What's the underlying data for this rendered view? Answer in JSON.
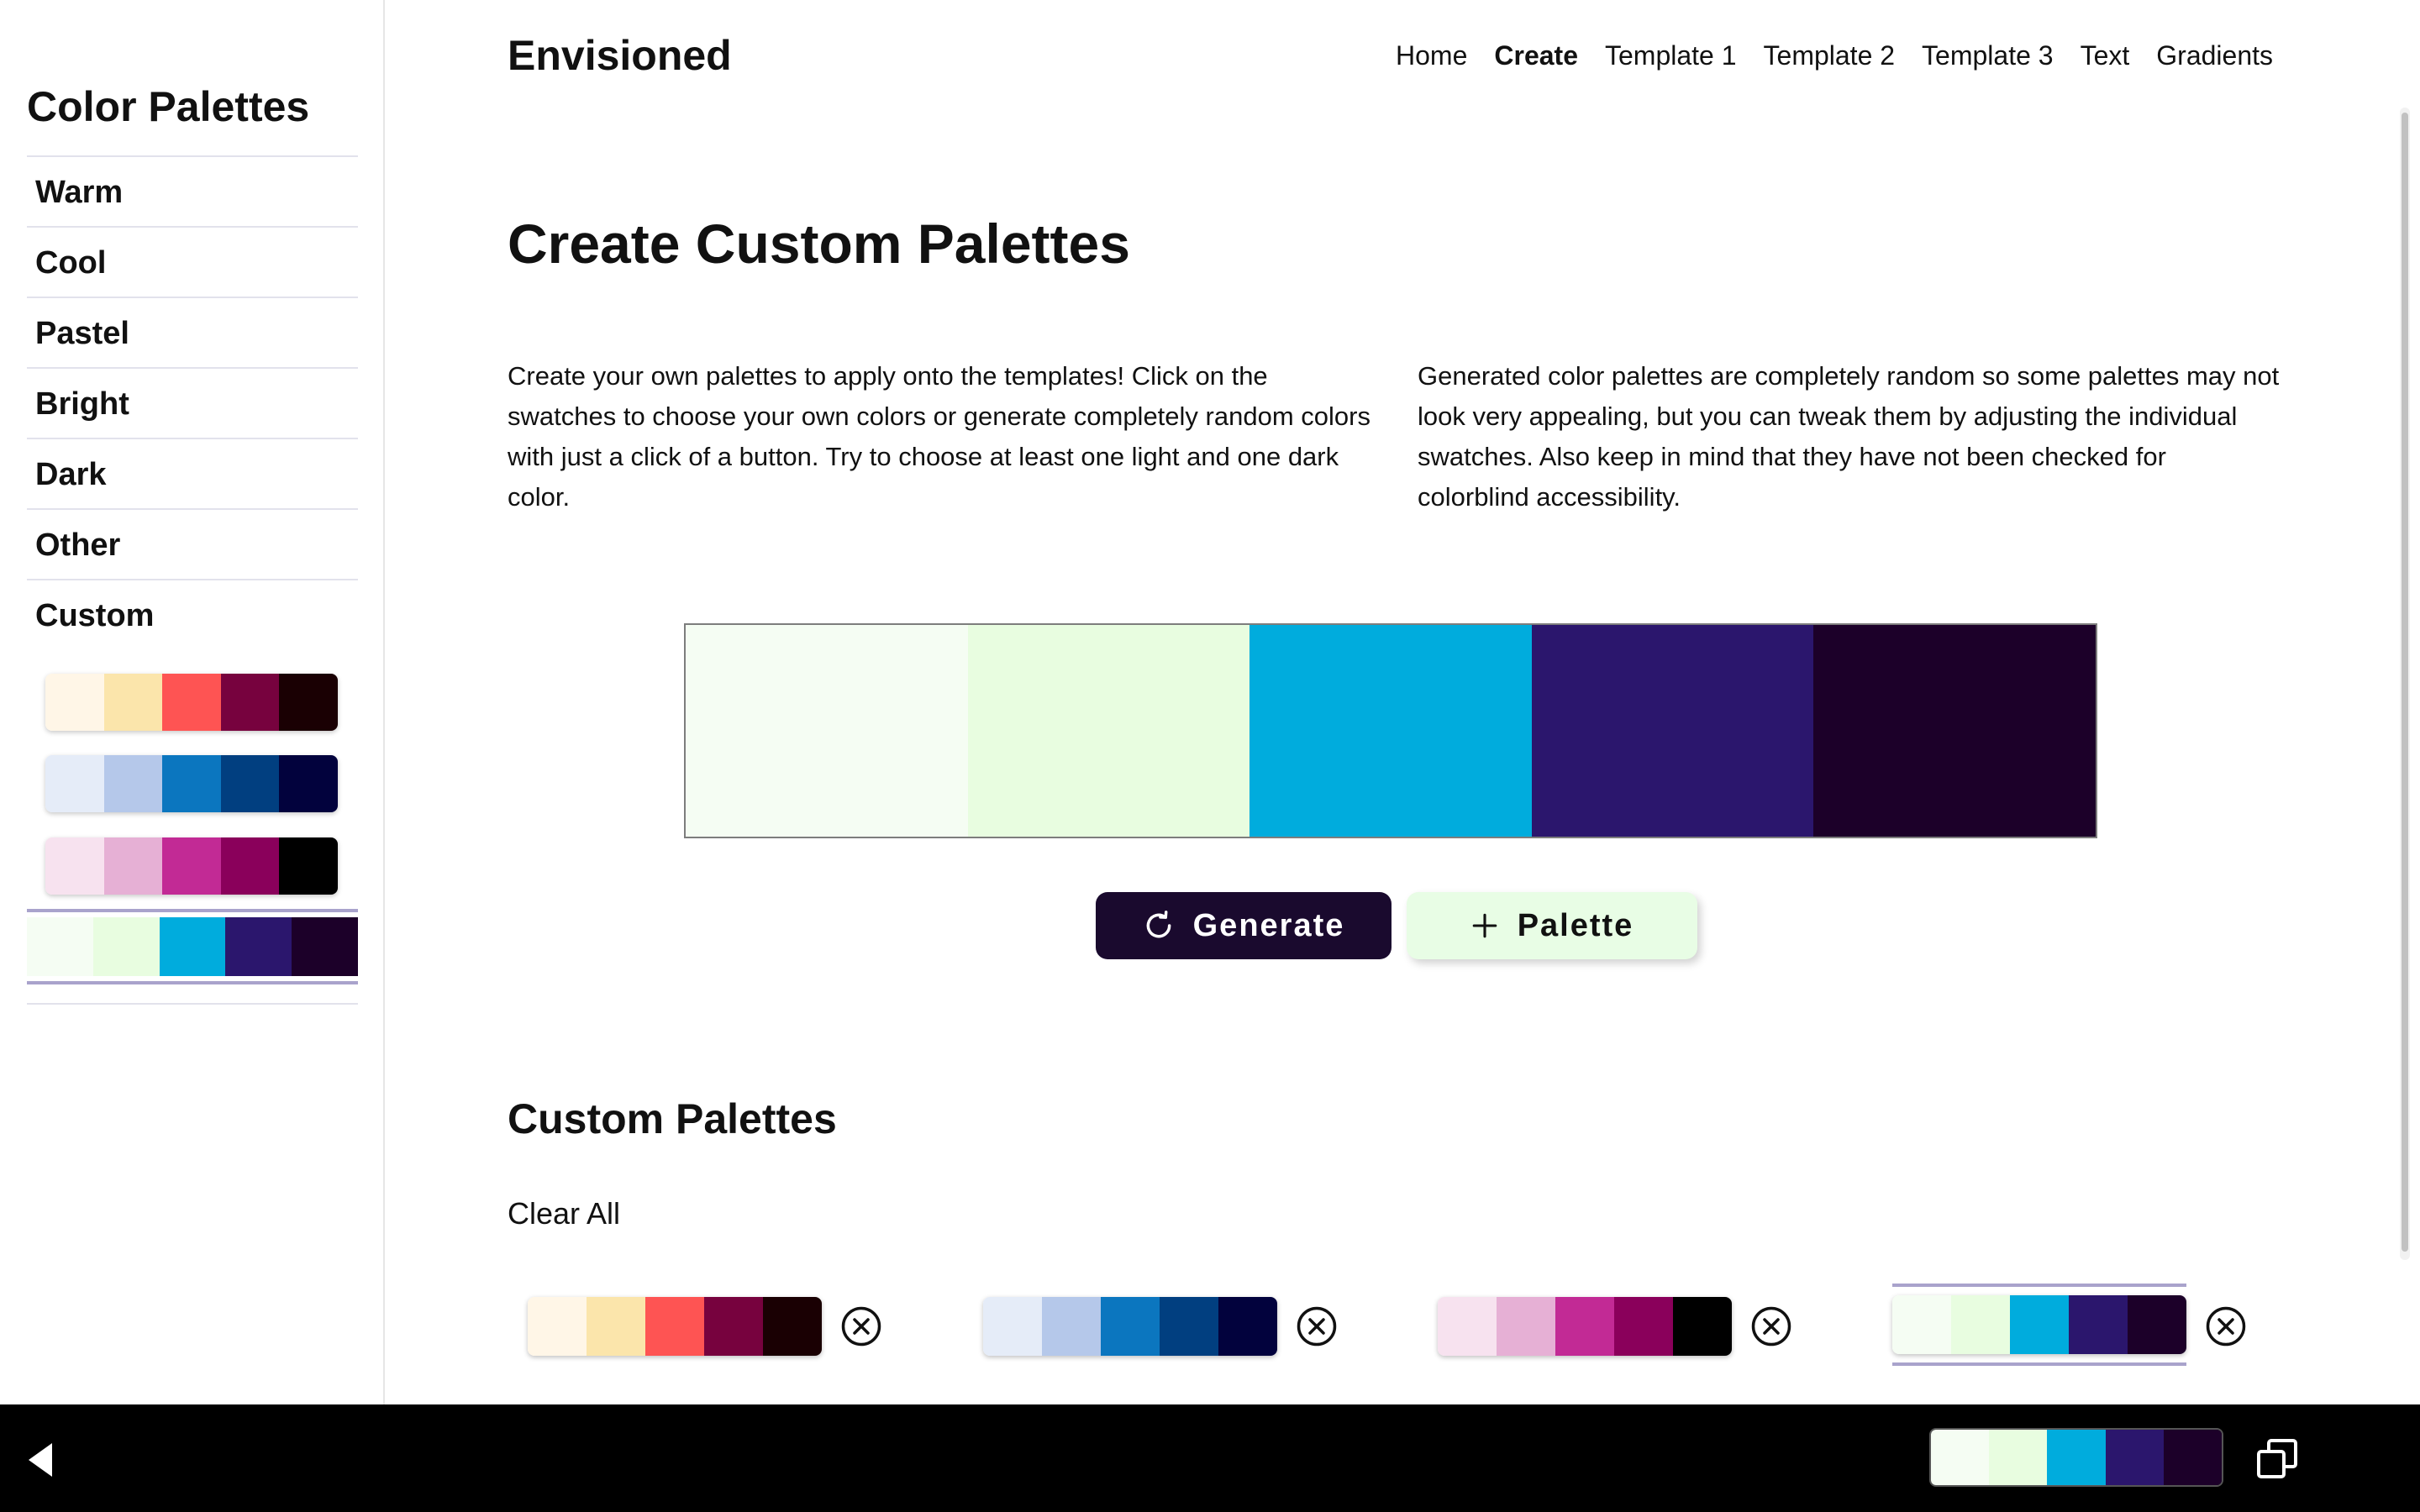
{
  "sidebar": {
    "title": "Color Palettes",
    "categories": [
      {
        "label": "Warm"
      },
      {
        "label": "Cool"
      },
      {
        "label": "Pastel"
      },
      {
        "label": "Bright"
      },
      {
        "label": "Dark"
      },
      {
        "label": "Other"
      },
      {
        "label": "Custom"
      }
    ]
  },
  "header": {
    "brand": "Envisioned",
    "nav": [
      {
        "label": "Home"
      },
      {
        "label": "Create",
        "active": true
      },
      {
        "label": "Template 1"
      },
      {
        "label": "Template 2"
      },
      {
        "label": "Template 3"
      },
      {
        "label": "Text"
      },
      {
        "label": "Gradients"
      }
    ]
  },
  "main": {
    "title": "Create Custom Palettes",
    "paragraph_left": "Create your own palettes to apply onto the templates! Click on the swatches to choose your own colors or generate completely random colors with just a click of a button. Try to choose at least one light and one dark color.",
    "paragraph_right": "Generated color palettes are completely random so some palettes may not look very appealing, but you can tweak them by adjusting the individual swatches. Also keep in mind that they have not been checked for colorblind accessibility.",
    "current_palette": [
      "#f5fdf3",
      "#e8fde0",
      "#00acdd",
      "#2b166d",
      "#1c0029"
    ],
    "generate_label": "Generate",
    "add_palette_label": "Palette",
    "section_title": "Custom Palettes",
    "clear_all_label": "Clear All"
  },
  "palettes": [
    [
      "#fff6e7",
      "#fbe5ab",
      "#fe5453",
      "#77023e",
      "#1a0003"
    ],
    [
      "#e5ecf8",
      "#b5c8ea",
      "#0b76bf",
      "#013f80",
      "#02023d"
    ],
    [
      "#f7e2ef",
      "#e6b0d5",
      "#c22a95",
      "#8a005b",
      "#000000"
    ],
    [
      "#f5fdf3",
      "#e8fde0",
      "#00acdd",
      "#2b166d",
      "#1c0029"
    ]
  ],
  "colors": {
    "generate_bg": "#1a0a2e",
    "palette_btn_bg": "#e8fde5",
    "active_border": "#a9a3cc"
  },
  "icons": {
    "generate": "refresh-icon",
    "add": "plus-icon",
    "remove": "close-circle-icon",
    "back": "back-triangle-icon",
    "window": "window-restore-icon"
  }
}
